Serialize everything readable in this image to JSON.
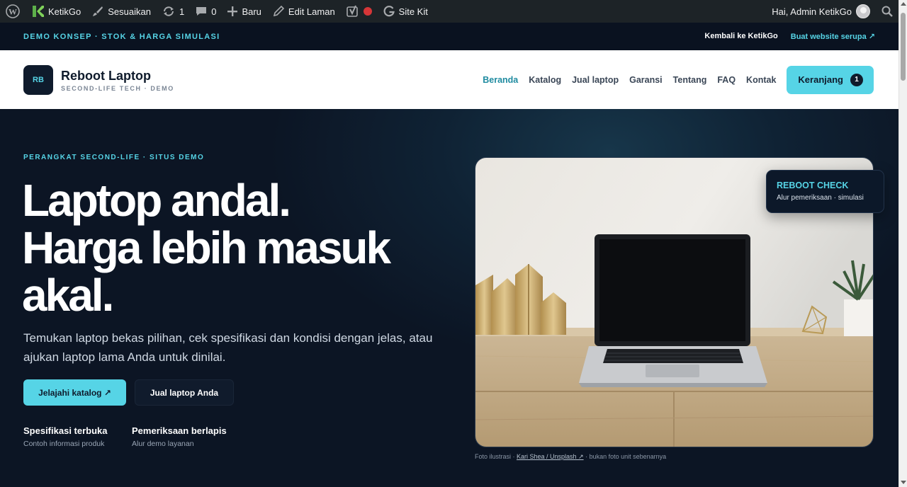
{
  "adminbar": {
    "site_name": "KetikGo",
    "customize": "Sesuaikan",
    "updates_count": "1",
    "comments_count": "0",
    "new_label": "Baru",
    "edit_page": "Edit Laman",
    "site_kit": "Site Kit",
    "greeting": "Hai, Admin KetikGo"
  },
  "announce": {
    "left": "DEMO KONSEP · STOK & HARGA SIMULASI",
    "back": "Kembali ke KetikGo",
    "build": "Buat website serupa ↗"
  },
  "header": {
    "logo_initials": "RB",
    "brand_name": "Reboot Laptop",
    "brand_tag": "SECOND-LIFE TECH · DEMO",
    "nav": [
      "Beranda",
      "Katalog",
      "Jual laptop",
      "Garansi",
      "Tentang",
      "FAQ",
      "Kontak"
    ],
    "cart_label": "Keranjang",
    "cart_count": "1"
  },
  "hero": {
    "eyebrow": "PERANGKAT SECOND-LIFE · SITUS DEMO",
    "headline": [
      "Laptop andal.",
      "Harga lebih masuk",
      "akal."
    ],
    "subtext": "Temukan laptop bekas pilihan, cek spesifikasi dan kondisi dengan jelas, atau ajukan laptop lama Anda untuk dinilai.",
    "primary_cta": "Jelajahi katalog ↗",
    "secondary_cta": "Jual laptop Anda",
    "features": [
      {
        "title": "Spesifikasi terbuka",
        "sub": "Contoh informasi produk"
      },
      {
        "title": "Pemeriksaan berlapis",
        "sub": "Alur demo layanan"
      }
    ],
    "check_card": {
      "title": "REBOOT CHECK",
      "sub": "Alur pemeriksaan · simulasi"
    },
    "caption": {
      "prefix": "Foto ilustrasi · ",
      "link": "Kari Shea / Unsplash ↗",
      "suffix": " · bukan foto unit sebenarnya"
    }
  },
  "colors": {
    "accent": "#56d4e6",
    "dark": "#0c1524",
    "admin_bar": "#1d2327"
  }
}
